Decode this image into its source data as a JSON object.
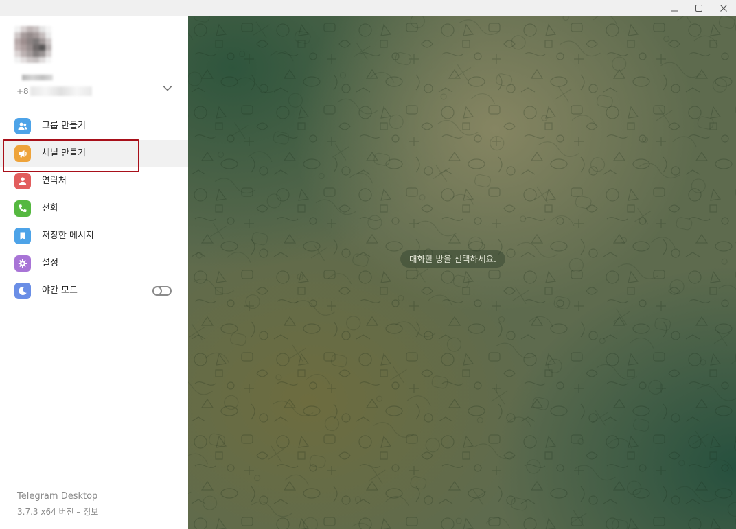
{
  "window": {
    "controls": {
      "minimize": "minimize-icon",
      "maximize": "maximize-icon",
      "close": "close-icon"
    }
  },
  "profile": {
    "phone_prefix": "+8"
  },
  "menu": {
    "items": [
      {
        "label": "그룹 만들기",
        "icon": "group-icon",
        "color": "#4da3e8"
      },
      {
        "label": "채널 만들기",
        "icon": "megaphone-icon",
        "color": "#eea33a"
      },
      {
        "label": "연락처",
        "icon": "contact-icon",
        "color": "#e25d5d"
      },
      {
        "label": "전화",
        "icon": "phone-icon",
        "color": "#55b840"
      },
      {
        "label": "저장한 메시지",
        "icon": "bookmark-icon",
        "color": "#4da3e8"
      },
      {
        "label": "설정",
        "icon": "gear-icon",
        "color": "#a874d6"
      },
      {
        "label": "야간 모드",
        "icon": "moon-icon",
        "color": "#6a8ee6"
      }
    ],
    "hovered_index": 1,
    "night_mode_on": false
  },
  "footer": {
    "app_name": "Telegram Desktop",
    "version_info": "3.7.3 x64 버전 – 정보"
  },
  "chat": {
    "empty_hint": "대화할 방을 선택하세요."
  },
  "colors": {
    "highlight_border": "#a8101a",
    "background_green": "#2c543c",
    "background_olive": "#6e6c3e"
  }
}
